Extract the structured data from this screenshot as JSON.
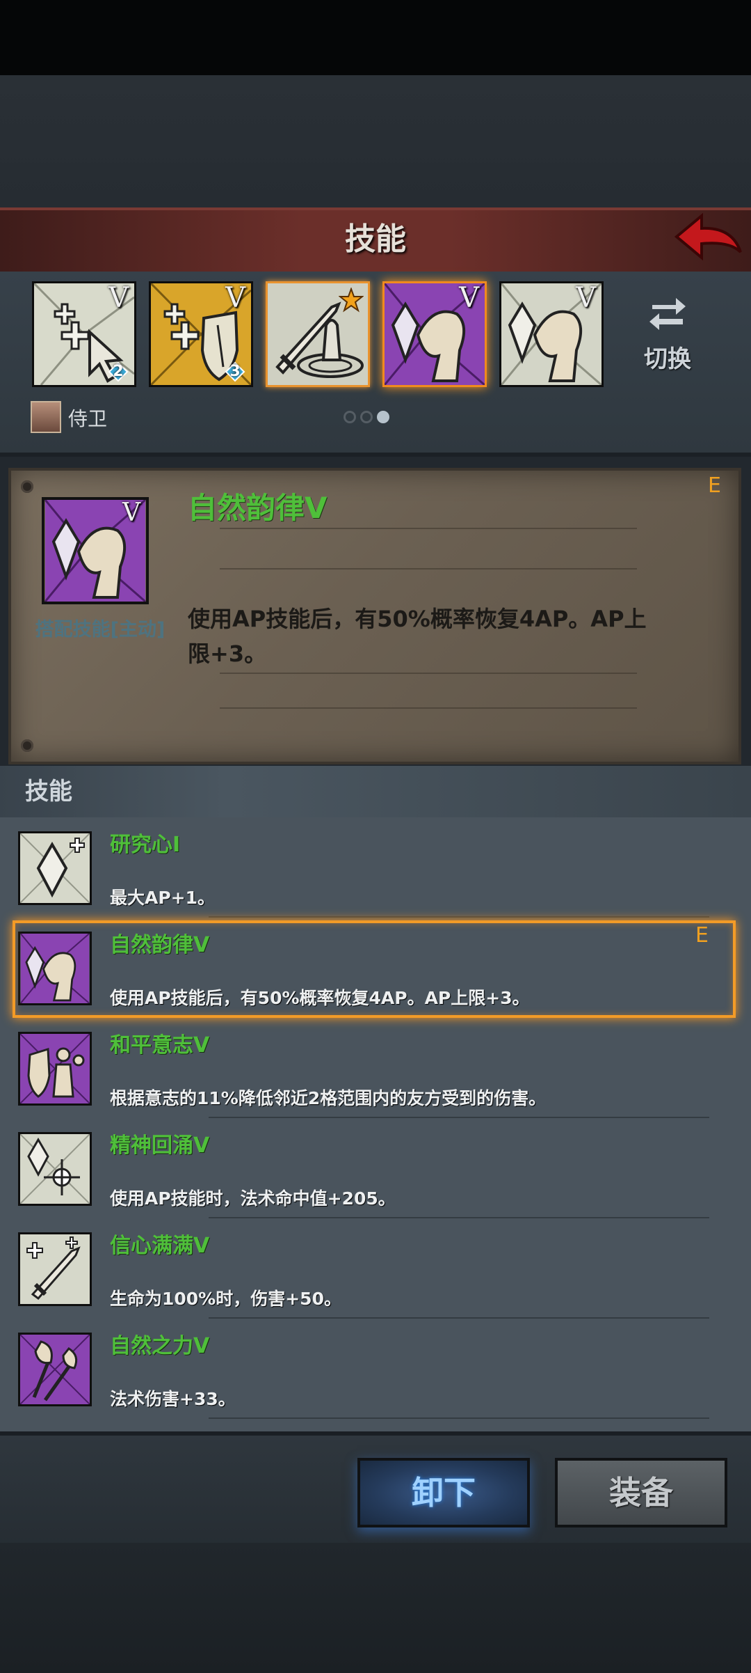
{
  "header": {
    "title": "技能",
    "back_icon": "red-back-arrow-icon"
  },
  "equipped_slots": [
    {
      "icon": "heal-cursor-icon",
      "level_mark": "V",
      "gem_count": "2"
    },
    {
      "icon": "heal-shield-icon",
      "level_mark": "V",
      "gem_count": "3"
    },
    {
      "icon": "sword-aura-icon",
      "badge": "star-icon"
    },
    {
      "icon": "crystal-arm-icon",
      "level_mark": "V"
    },
    {
      "icon": "crystal-arm-icon",
      "level_mark": "V"
    }
  ],
  "switch": {
    "label": "切换",
    "icon": "swap-arrows-icon"
  },
  "owner": {
    "name": "侍卫"
  },
  "pagination": {
    "pages": 3,
    "current": 3
  },
  "detail": {
    "grade": "E",
    "name": "自然韵律V",
    "level_mark": "V",
    "type": "搭配技能[主动]",
    "description": "使用AP技能后，有50%概率恢复4AP。AP上限+3。"
  },
  "skills_section": {
    "title": "技能"
  },
  "skills": [
    {
      "name": "研究心I",
      "desc": "最大AP+1。",
      "icon": "crystal-plus-icon"
    },
    {
      "name": "自然韵律V",
      "desc": "使用AP技能后，有50%概率恢复4AP。AP上限+3。",
      "icon": "crystal-arm-icon",
      "grade": "E",
      "selected": true
    },
    {
      "name": "和平意志V",
      "desc": "根据意志的11%降低邻近2格范围内的友方受到的伤害。",
      "icon": "protect-allies-icon"
    },
    {
      "name": "精神回涌V",
      "desc": "使用AP技能时，法术命中值+205。",
      "icon": "crystal-target-icon"
    },
    {
      "name": "信心满满V",
      "desc": "生命为100%时，伤害+50。",
      "icon": "heal-sword-icon"
    },
    {
      "name": "自然之力V",
      "desc": "法术伤害+33。",
      "icon": "nature-staff-icon"
    }
  ],
  "footer": {
    "unequip_label": "卸下",
    "equip_label": "装备"
  },
  "colors": {
    "skill_name": "#4fbf3a",
    "highlight": "#f39b27",
    "title_bar": "#6b2f2a"
  }
}
